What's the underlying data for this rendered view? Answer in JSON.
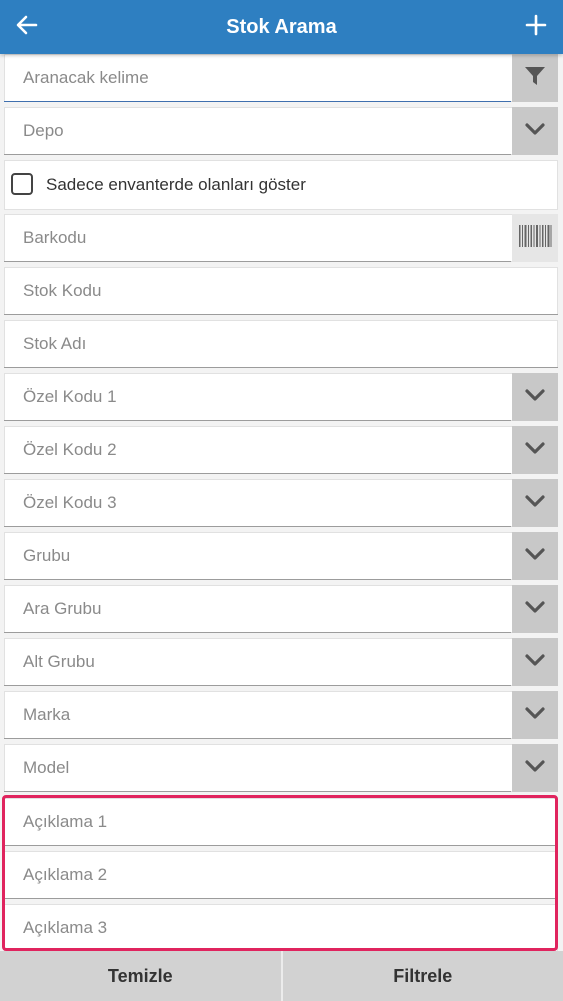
{
  "header": {
    "title": "Stok Arama",
    "back_icon": "arrow-left-icon",
    "add_icon": "plus-icon",
    "color": "#2e7fc1"
  },
  "search": {
    "placeholder": "Aranacak kelime",
    "filter_icon": "funnel-icon"
  },
  "depo": {
    "placeholder": "Depo"
  },
  "inventory_only": {
    "label": "Sadece envanterde olanları göster",
    "checked": false
  },
  "fields": {
    "barkodu": "Barkodu",
    "stok_kodu": "Stok Kodu",
    "stok_adi": "Stok Adı",
    "ozel_kodu_1": "Özel Kodu 1",
    "ozel_kodu_2": "Özel Kodu 2",
    "ozel_kodu_3": "Özel Kodu 3",
    "grubu": "Grubu",
    "ara_grubu": "Ara Grubu",
    "alt_grubu": "Alt Grubu",
    "marka": "Marka",
    "model": "Model",
    "aciklama_1": "Açıklama 1",
    "aciklama_2": "Açıklama 2",
    "aciklama_3": "Açıklama 3"
  },
  "actions": {
    "clear_label": "Temizle",
    "filter_label": "Filtrele"
  },
  "colors": {
    "highlight": "#e0245e",
    "dropdown_button": "#c8c8c8"
  }
}
